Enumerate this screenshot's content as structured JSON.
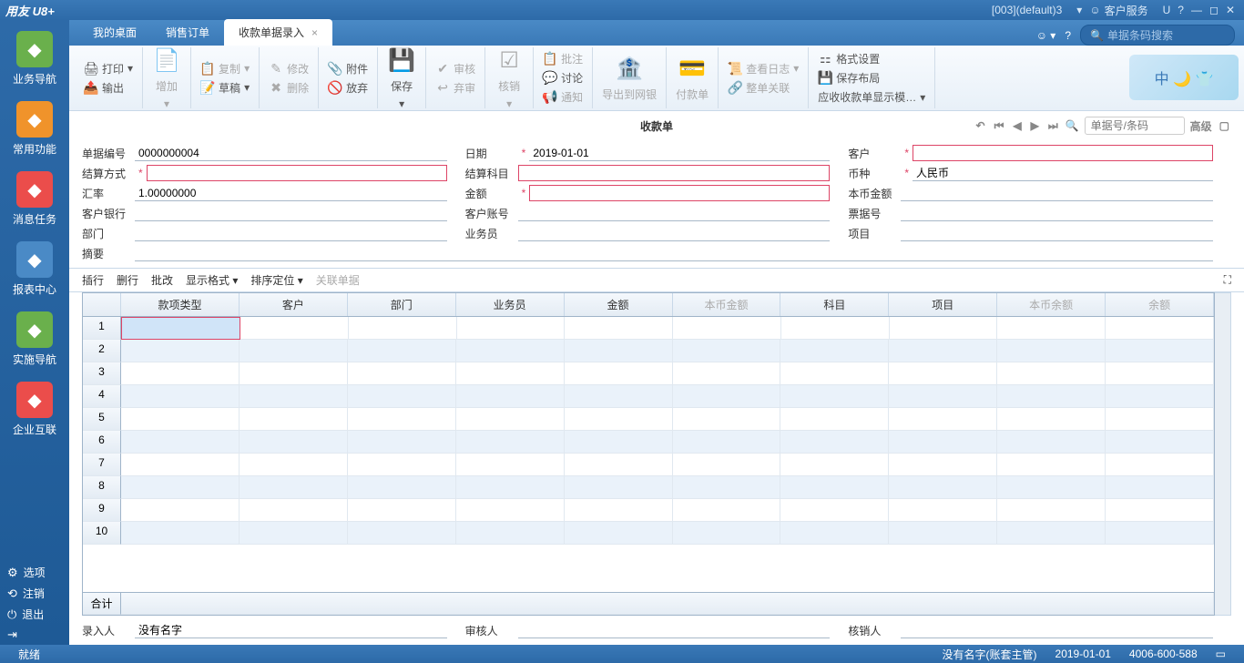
{
  "titlebar": {
    "logo": "用友 U8+",
    "info": "[003](default)3",
    "service": "客户服务",
    "u": "U"
  },
  "sidebar": {
    "items": [
      {
        "label": "业务导航",
        "bg": "#6ab04c"
      },
      {
        "label": "常用功能",
        "bg": "#f0932b"
      },
      {
        "label": "消息任务",
        "bg": "#eb4d4b"
      },
      {
        "label": "报表中心",
        "bg": "#4a8ac6"
      },
      {
        "label": "实施导航",
        "bg": "#6ab04c"
      },
      {
        "label": "企业互联",
        "bg": "#eb4d4b"
      }
    ],
    "foot": {
      "opt": "选项",
      "logout": "注销",
      "exit": "退出"
    }
  },
  "tabs": [
    {
      "label": "我的桌面",
      "active": false
    },
    {
      "label": "销售订单",
      "active": false
    },
    {
      "label": "收款单据录入",
      "active": true
    }
  ],
  "search_placeholder": "单据条码搜索",
  "ribbon": {
    "print": "打印",
    "output": "输出",
    "add": "增加",
    "copy": "复制",
    "draft": "草稿",
    "edit": "修改",
    "delete": "删除",
    "attach": "附件",
    "discard": "放弃",
    "save": "保存",
    "audit": "审核",
    "abandon": "弃审",
    "verify": "核销",
    "approve": "批注",
    "discuss": "讨论",
    "notify": "通知",
    "export_bank": "导出到网银",
    "pay": "付款单",
    "viewlog": "查看日志",
    "wholeclose": "整单关联",
    "format": "格式设置",
    "savelayout": "保存布局",
    "display_mode": "应收收款单显示模…"
  },
  "doc": {
    "title": "收款单",
    "nav_placeholder": "单据号/条码",
    "advanced": "高级"
  },
  "form": {
    "doc_no_label": "单据编号",
    "doc_no": "0000000004",
    "date_label": "日期",
    "date": "2019-01-01",
    "customer_label": "客户",
    "customer": "",
    "settle_label": "结算方式",
    "settle": "",
    "settle_sub_label": "结算科目",
    "settle_sub": "",
    "currency_label": "币种",
    "currency": "人民币",
    "rate_label": "汇率",
    "rate": "1.00000000",
    "amount_label": "金额",
    "amount": "",
    "local_amount_label": "本币金额",
    "local_amount": "",
    "cust_bank_label": "客户银行",
    "cust_bank": "",
    "cust_acc_label": "客户账号",
    "cust_acc": "",
    "bill_no_label": "票据号",
    "bill_no": "",
    "dept_label": "部门",
    "dept": "",
    "clerk_label": "业务员",
    "clerk": "",
    "project_label": "项目",
    "project": "",
    "summary_label": "摘要",
    "summary": ""
  },
  "gridbar": {
    "insert": "插行",
    "delete": "删行",
    "batch": "批改",
    "format": "显示格式",
    "sort": "排序定位",
    "assoc": "关联单据"
  },
  "grid": {
    "headers": [
      "款项类型",
      "客户",
      "部门",
      "业务员",
      "金额",
      "本币金额",
      "科目",
      "项目",
      "本币余额",
      "余额"
    ],
    "rows": 10,
    "total_label": "合计"
  },
  "footform": {
    "entry_label": "录入人",
    "entry": "没有名字",
    "audit_label": "审核人",
    "audit": "",
    "verify_label": "核销人",
    "verify": ""
  },
  "statusbar": {
    "ready": "就绪",
    "user": "没有名字(账套主管)",
    "date": "2019-01-01",
    "phone": "4006-600-588"
  }
}
